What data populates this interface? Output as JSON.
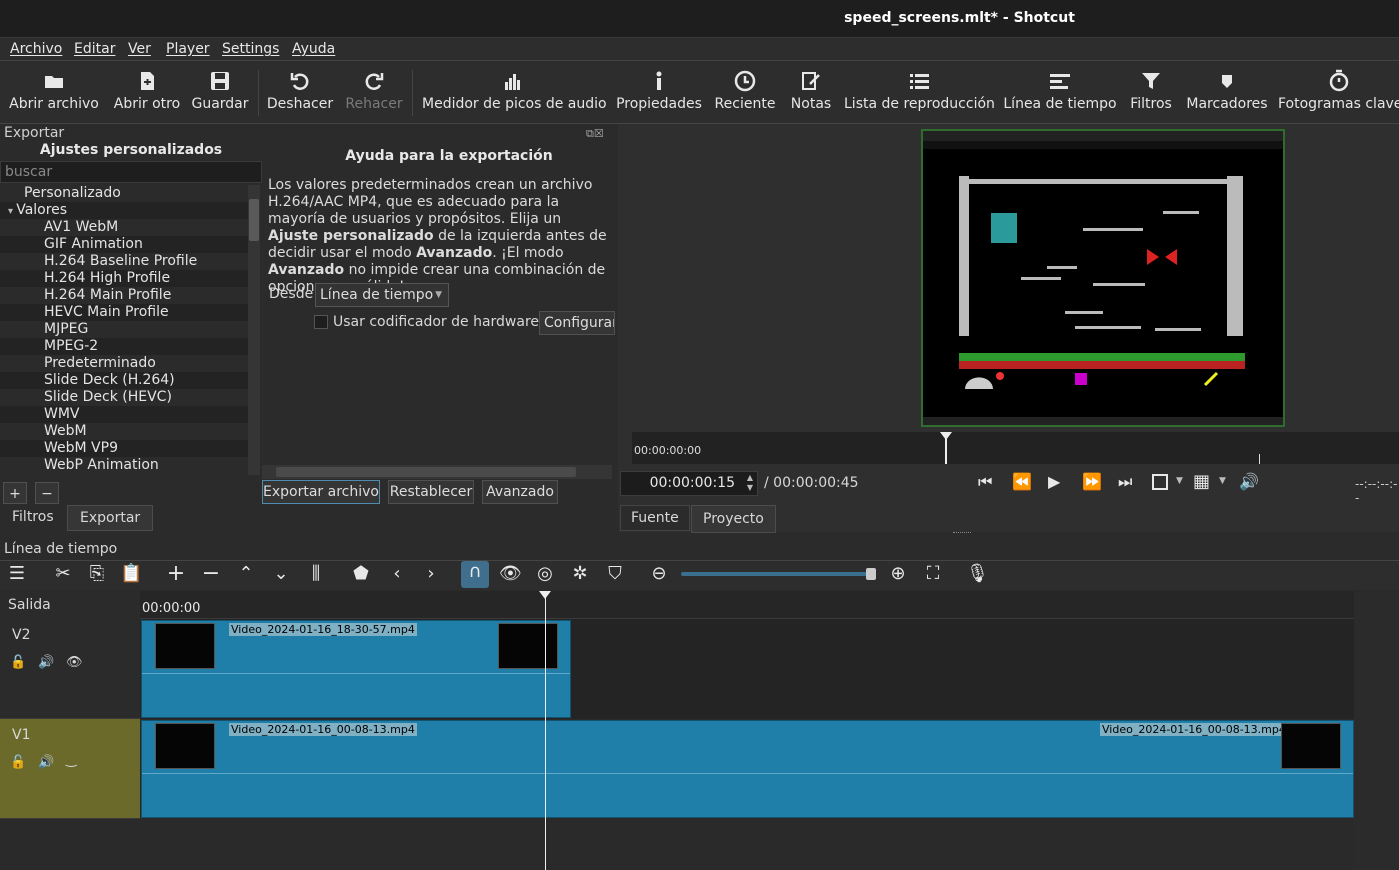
{
  "window": {
    "title": "speed_screens.mlt* - Shotcut"
  },
  "menu": [
    "Archivo",
    "Editar",
    "Ver",
    "Player",
    "Settings",
    "Ayuda"
  ],
  "toolbar": [
    {
      "label": "Abrir archivo",
      "icon": "folder-open-icon"
    },
    {
      "label": "Abrir otro",
      "icon": "file-open-other-icon"
    },
    {
      "label": "Guardar",
      "icon": "save-icon"
    },
    {
      "label": "Deshacer",
      "icon": "undo-icon"
    },
    {
      "label": "Rehacer",
      "icon": "redo-icon"
    },
    {
      "label": "Medidor de picos de audio",
      "icon": "audio-meter-icon"
    },
    {
      "label": "Propiedades",
      "icon": "info-icon"
    },
    {
      "label": "Reciente",
      "icon": "clock-icon"
    },
    {
      "label": "Notas",
      "icon": "notes-icon"
    },
    {
      "label": "Lista de reproducción",
      "icon": "list-icon"
    },
    {
      "label": "Línea de tiempo",
      "icon": "timeline-icon"
    },
    {
      "label": "Filtros",
      "icon": "filter-icon"
    },
    {
      "label": "Marcadores",
      "icon": "marker-icon"
    },
    {
      "label": "Fotogramas clave",
      "icon": "stopwatch-icon"
    }
  ],
  "export": {
    "panel_title": "Exportar",
    "presets_title": "Ajustes personalizados",
    "search_placeholder": "buscar",
    "presets": [
      "Personalizado",
      "Valores",
      "AV1 WebM",
      "GIF Animation",
      "H.264 Baseline Profile",
      "H.264 High Profile",
      "H.264 Main Profile",
      "HEVC Main Profile",
      "MJPEG",
      "MPEG-2",
      "Predeterminado",
      "Slide Deck (H.264)",
      "Slide Deck (HEVC)",
      "WMV",
      "WebM",
      "WebM VP9",
      "WebP Animation"
    ],
    "help_title": "Ayuda para la exportación",
    "help_p1": "Los valores predeterminados crean un archivo H.264/AAC MP4, que es adecuado para la mayoría de usuarios y propósitos. Elija un ",
    "help_b1": "Ajuste personalizado",
    "help_p2": " de la izquierda antes de decidir usar el modo ",
    "help_b2": "Avanzado",
    "help_p3": ". ¡El modo ",
    "help_b3": "Avanzado",
    "help_p4": " no impide crear una combinación de opciones no válida!",
    "from_label": "Desde",
    "from_value": "Línea de tiempo",
    "hw_encoder_label": "Usar codificador de hardware",
    "configure_label": "Configurar",
    "export_button": "Exportar archivo",
    "reset_button": "Restablecer",
    "advanced_button": "Avanzado",
    "add_label": "+",
    "remove_label": "−"
  },
  "left_tabs": [
    "Filtros",
    "Exportar"
  ],
  "player": {
    "ruler_time": "00:00:00:00",
    "current_time": "00:00:00:15",
    "total_time": "/ 00:00:00:45",
    "end_time": "--:--:--:--",
    "tabs": [
      "Fuente",
      "Proyecto"
    ]
  },
  "timeline": {
    "title": "Línea de tiempo",
    "output_label": "Salida",
    "ruler_time": "00:00:00",
    "tracks": [
      {
        "name": "V2",
        "clips": [
          "Video_2024-01-16_18-30-57.mp4"
        ]
      },
      {
        "name": "V1",
        "clips": [
          "Video_2024-01-16_00-08-13.mp4",
          "Video_2024-01-16_00-08-13.mp4"
        ]
      }
    ]
  },
  "colors": {
    "accent": "#1f7fa8",
    "v1_header": "#6b6a2a",
    "preview_border": "#2f6d2f"
  }
}
